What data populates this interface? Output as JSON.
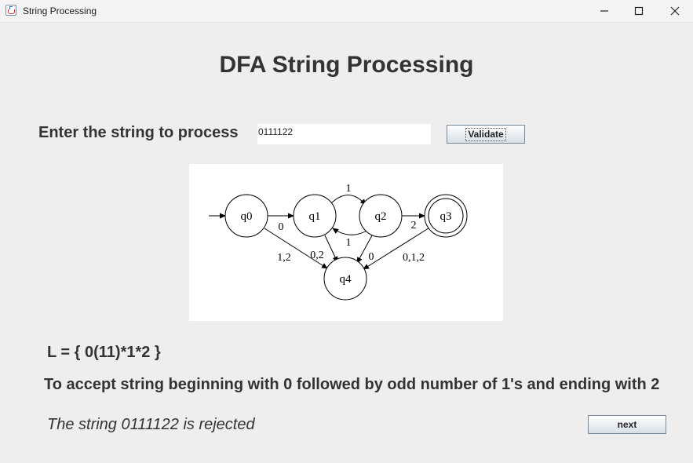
{
  "window": {
    "title": "String Processing",
    "icon": "java-cup-icon"
  },
  "header": {
    "title": "DFA String Processing"
  },
  "input_section": {
    "label": "Enter the string to process",
    "input_value": "0111122",
    "validate_label": "Validate"
  },
  "diagram": {
    "states": [
      "q0",
      "q1",
      "q2",
      "q3",
      "q4"
    ],
    "start_state": "q0",
    "accept_state": "q3",
    "transitions": [
      {
        "from": "q0",
        "to": "q1",
        "label": "0"
      },
      {
        "from": "q0",
        "to": "q4",
        "label": "1,2"
      },
      {
        "from": "q1",
        "to": "q2",
        "label": "1"
      },
      {
        "from": "q2",
        "to": "q1",
        "label": "1"
      },
      {
        "from": "q1",
        "to": "q4",
        "label": "0,2"
      },
      {
        "from": "q2",
        "to": "q4",
        "label": "0"
      },
      {
        "from": "q2",
        "to": "q3",
        "label": "2"
      },
      {
        "from": "q3",
        "to": "q4",
        "label": "0,1,2"
      }
    ]
  },
  "language": {
    "expression": "L = { 0(11)*1*2 }"
  },
  "description": "To accept string beginning with 0 followed by odd number of 1's and ending with 2",
  "result": {
    "message": "The string 0111122 is rejected"
  },
  "next_label": "next"
}
